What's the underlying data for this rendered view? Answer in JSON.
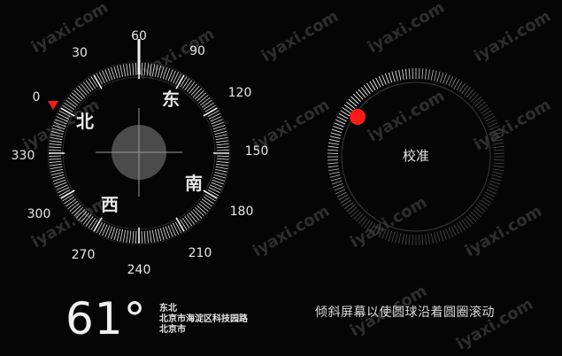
{
  "compass": {
    "heading_value": "61°",
    "direction_name": "东北",
    "address_line": "北京市海淀区科技园路",
    "city": "北京市",
    "tick_labels": [
      "0",
      "30",
      "60",
      "90",
      "120",
      "150",
      "180",
      "210",
      "240",
      "270",
      "300",
      "330"
    ],
    "cardinals": {
      "north": "北",
      "east": "东",
      "south": "南",
      "west": "西"
    },
    "heading_degrees": 61
  },
  "calibration": {
    "center_label": "校准",
    "hint": "倾斜屏幕以使圆球沿着圆圈滚动"
  },
  "watermark": "iyaxi.com",
  "colors": {
    "background": "#050505",
    "marker_red": "#ff1a1a",
    "text": "#ededed"
  }
}
